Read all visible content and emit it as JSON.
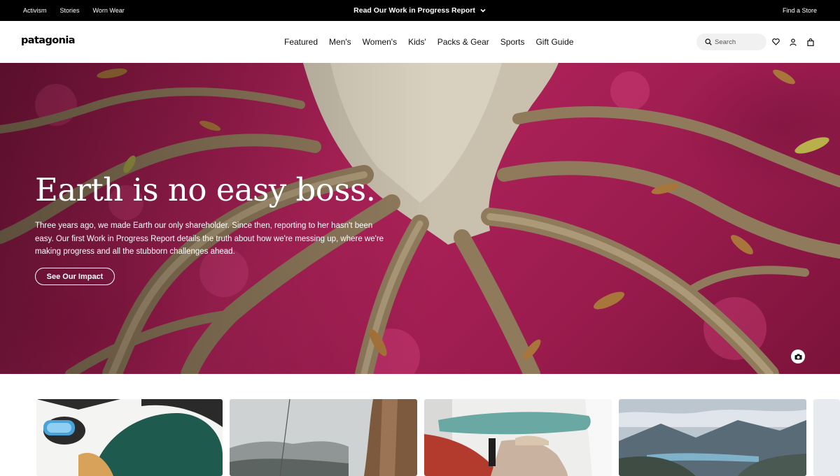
{
  "utility_bar": {
    "links": [
      "Activism",
      "Stories",
      "Worn Wear"
    ],
    "promo": "Read Our Work in Progress Report",
    "store": "Find a Store"
  },
  "header": {
    "logo": "patagonia",
    "nav": [
      "Featured",
      "Men's",
      "Women's",
      "Kids'",
      "Packs & Gear",
      "Sports",
      "Gift Guide"
    ],
    "search_placeholder": "Search"
  },
  "hero": {
    "title": "Earth is no easy boss.",
    "body": "Three years ago, we made Earth our only shareholder. Since then, reporting to her hasn't been easy. Our first Work in Progress Report details the truth about how we're messing up, where we're making progress and all the stubborn challenges ahead.",
    "cta": "See Our Impact"
  },
  "icons": {
    "promo_chevron": "chevron-down-icon",
    "search": "search-icon",
    "wishlist": "heart-icon",
    "account": "user-icon",
    "bag": "bag-icon",
    "photo_credit": "camera-icon"
  },
  "colors": {
    "utility_bar_bg": "#000000",
    "hero_accent": "#b0235a",
    "text": "#111111"
  }
}
